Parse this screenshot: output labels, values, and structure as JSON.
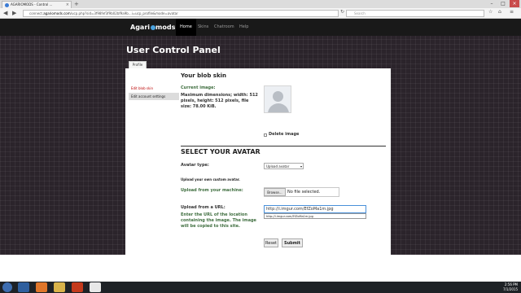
{
  "browser": {
    "tab_title": "AGARIOMODS - Control ...",
    "tab_close": "×",
    "new_tab": "+",
    "url_prefix": "connect.",
    "url_host": "agariomods.com",
    "url_rest": "/ucp.php?sid=3f98fef3f9b02bf9a9b...i=ucp_profile&mode=avatar",
    "search_placeholder": "Search",
    "window_controls": [
      "–",
      "□",
      "×"
    ]
  },
  "site": {
    "logo_left": "Agari",
    "logo_right": "mods.com",
    "nav": [
      {
        "label": "Home",
        "active": true
      },
      {
        "label": "Skins",
        "active": false
      },
      {
        "label": "Chatroom",
        "active": false
      },
      {
        "label": "Help",
        "active": false
      }
    ],
    "page_title": "User Control Panel",
    "content_tab": "Profile"
  },
  "sidebar": {
    "items": [
      {
        "label": "Edit blob skin"
      },
      {
        "label": "Edit account settings"
      }
    ]
  },
  "blob": {
    "heading": "Your blob skin",
    "current_image_label": "Current image:",
    "dimensions_text_1": "Maximum dimensions; width: 512",
    "dimensions_text_2": "pixels, height: 512 pixels, file",
    "dimensions_text_3": "size: 78.00 KiB.",
    "delete_label": "Delete image"
  },
  "avatar": {
    "heading": "SELECT YOUR AVATAR",
    "type_label": "Avatar type:",
    "type_value": "Upload avatar",
    "custom_note": "Upload your own custom avatar.",
    "upload_machine_label": "Upload from your machine:",
    "browse_button": "Browse...",
    "no_file_text": "No file selected.",
    "upload_url_label": "Upload from a URL:",
    "url_desc_1": "Enter the URL of the location",
    "url_desc_2": "containing the image. The image",
    "url_desc_3": "will be copied to this site.",
    "url_value": "http://i.imgur.com/EfZoMa1m.jpg",
    "url_suggestion": "http://i.imgur.com/EfZoMa1m.jpg",
    "reset_button": "Reset",
    "submit_button": "Submit"
  },
  "taskbar": {
    "time": "2:56 PM",
    "date": "7/1/2015"
  },
  "colors": {
    "site_background": "#2b242b",
    "topnav": "#191919",
    "active_sidebar": "#bb0000",
    "label_green": "#3f6e3f"
  }
}
